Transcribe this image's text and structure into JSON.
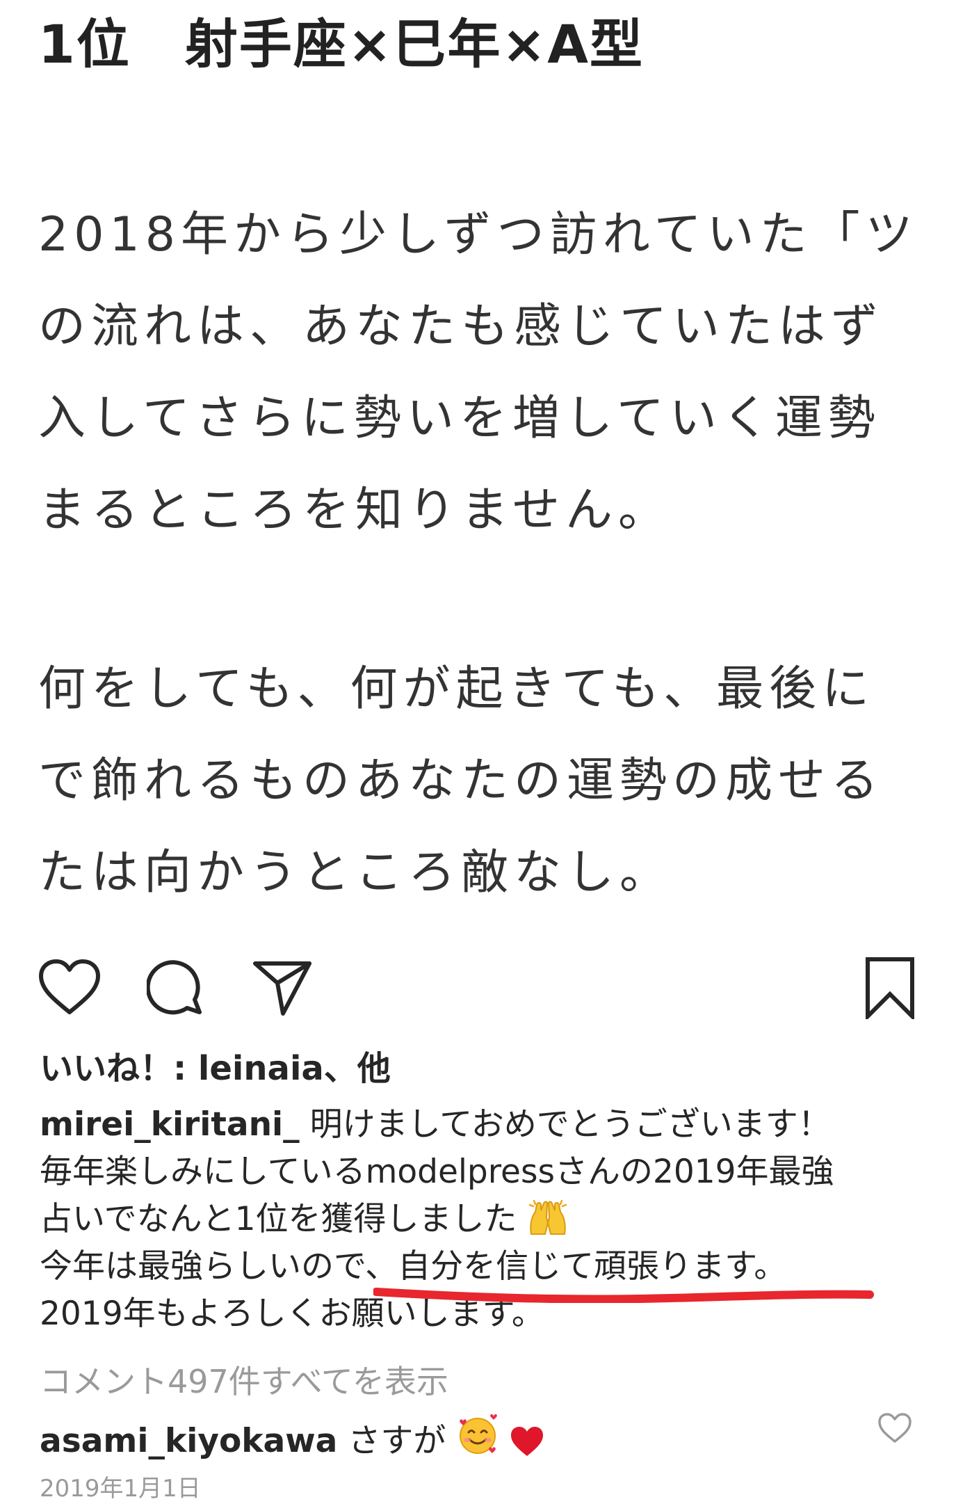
{
  "post_image": {
    "title": "1位　射手座×巳年×A型",
    "paragraph_1": [
      "2018年から少しずつ訪れていた「ツ",
      "の流れは、あなたも感じていたはず",
      "入してさらに勢いを増していく運勢",
      "まるところを知りません。"
    ],
    "paragraph_2": [
      "何をしても、何が起きても、最後に",
      "で飾れるものあなたの運勢の成せる",
      "たは向かうところ敵なし。"
    ]
  },
  "actions": {
    "like_icon": "heart-outline-icon",
    "comment_icon": "speech-bubble-icon",
    "share_icon": "paper-plane-icon",
    "save_icon": "bookmark-icon"
  },
  "likes": {
    "prefix": "いいね！: ",
    "user": "leinaia",
    "suffix": "、他"
  },
  "caption": {
    "username": "mirei_kiritani_",
    "line_1": " 明けましておめでとうございます！",
    "line_2": "毎年楽しみにしているmodelpressさんの2019年最強",
    "line_3": "占いでなんと1位を獲得しました",
    "line_4_pre": "今年は最強らしいので、",
    "line_4_highlight": "自分を信じて頑張ります。",
    "line_5": "2019年もよろしくお願いします。",
    "highlight_color": "#e8262d"
  },
  "view_comments": "コメント497件すべてを表示",
  "comment": {
    "username": "asami_kiyokawa",
    "text": " さすが"
  },
  "date": "2019年1月1日",
  "colors": {
    "text": "#262626",
    "muted": "#9a9a9a",
    "heart_red": "#e0162b"
  }
}
